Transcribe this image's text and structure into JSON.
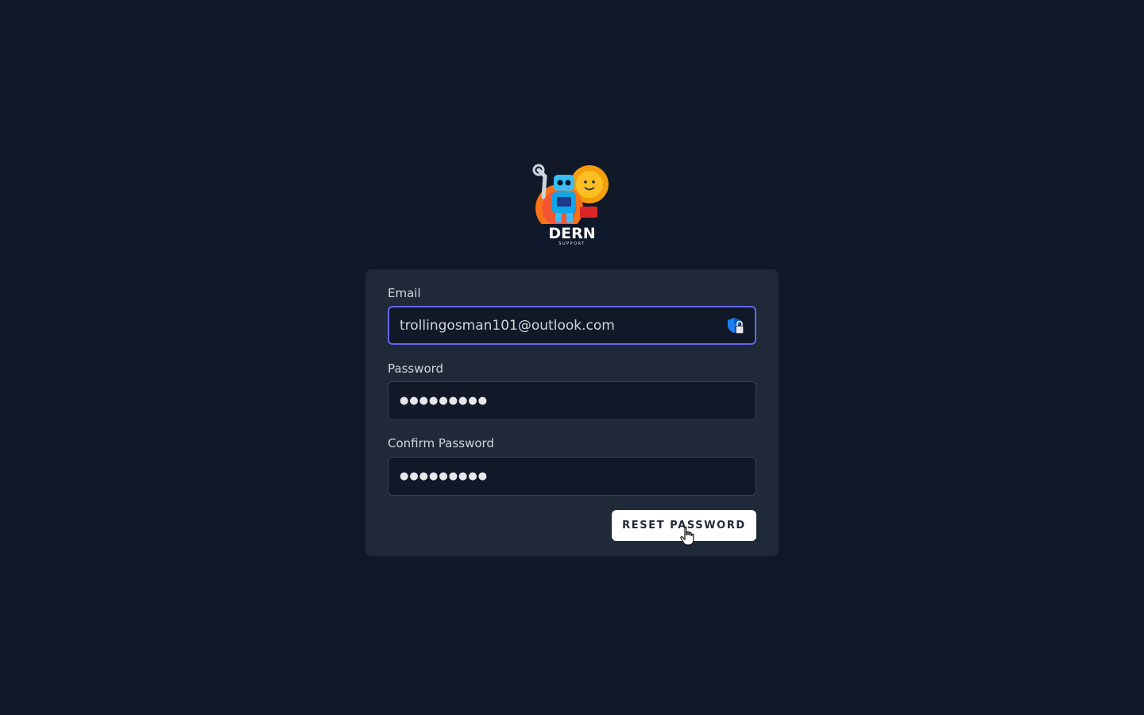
{
  "logo": {
    "brand_text": "DERN",
    "sub_text": "SUPPORT"
  },
  "form": {
    "email_label": "Email",
    "email_value": "trollingosman101@outlook.com",
    "password_label": "Password",
    "password_value": "●●●●●●●●●",
    "confirm_label": "Confirm Password",
    "confirm_value": "●●●●●●●●●",
    "submit_label": "RESET PASSWORD"
  },
  "icons": {
    "password_manager": "shield-lock-icon",
    "cursor": "hand-pointer-icon"
  },
  "colors": {
    "background": "#111827",
    "card": "#1f2937",
    "focus_ring": "#6366f1",
    "button": "#ffffff"
  }
}
